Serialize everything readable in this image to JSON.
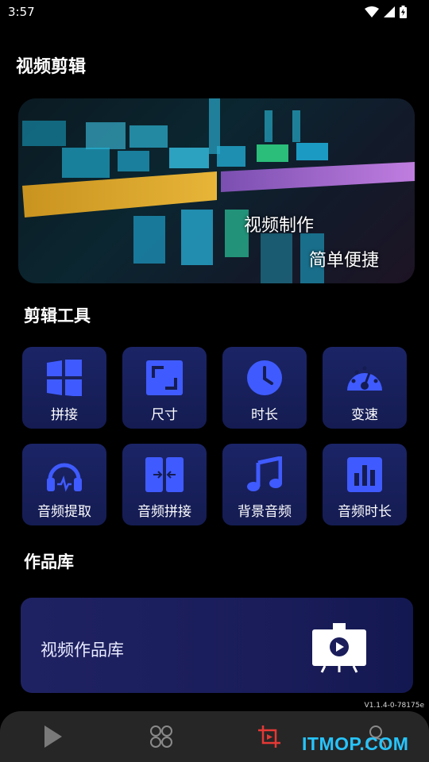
{
  "status_bar": {
    "time": "3:57",
    "icons": [
      "wifi-icon",
      "signal-icon",
      "battery-charging-icon"
    ]
  },
  "page": {
    "title": "视频剪辑"
  },
  "banner": {
    "line1": "视频制作",
    "line2": "简单便捷"
  },
  "tools": {
    "title": "剪辑工具",
    "items": [
      {
        "label": "拼接",
        "icon": "grid-icon"
      },
      {
        "label": "尺寸",
        "icon": "resize-icon"
      },
      {
        "label": "时长",
        "icon": "clock-icon"
      },
      {
        "label": "变速",
        "icon": "speedometer-icon"
      },
      {
        "label": "音频提取",
        "icon": "headphones-icon"
      },
      {
        "label": "音频拼接",
        "icon": "merge-icon"
      },
      {
        "label": "背景音频",
        "icon": "music-note-icon"
      },
      {
        "label": "音频时长",
        "icon": "bar-chart-icon"
      }
    ]
  },
  "gallery": {
    "title": "作品库",
    "card_label": "视频作品库",
    "icon": "video-gallery-icon"
  },
  "version": "V1.1.4-0-78175e",
  "bottom_nav": {
    "items": [
      {
        "icon": "play-icon"
      },
      {
        "icon": "apps-icon"
      },
      {
        "icon": "crop-icon",
        "active": true
      },
      {
        "icon": "user-icon"
      }
    ],
    "active_color": "#e53935"
  },
  "watermark": "ITMOP.COM",
  "colors": {
    "accent": "#3a57ff",
    "card_bg": "#1b2466",
    "watermark": "#26c5ff"
  }
}
